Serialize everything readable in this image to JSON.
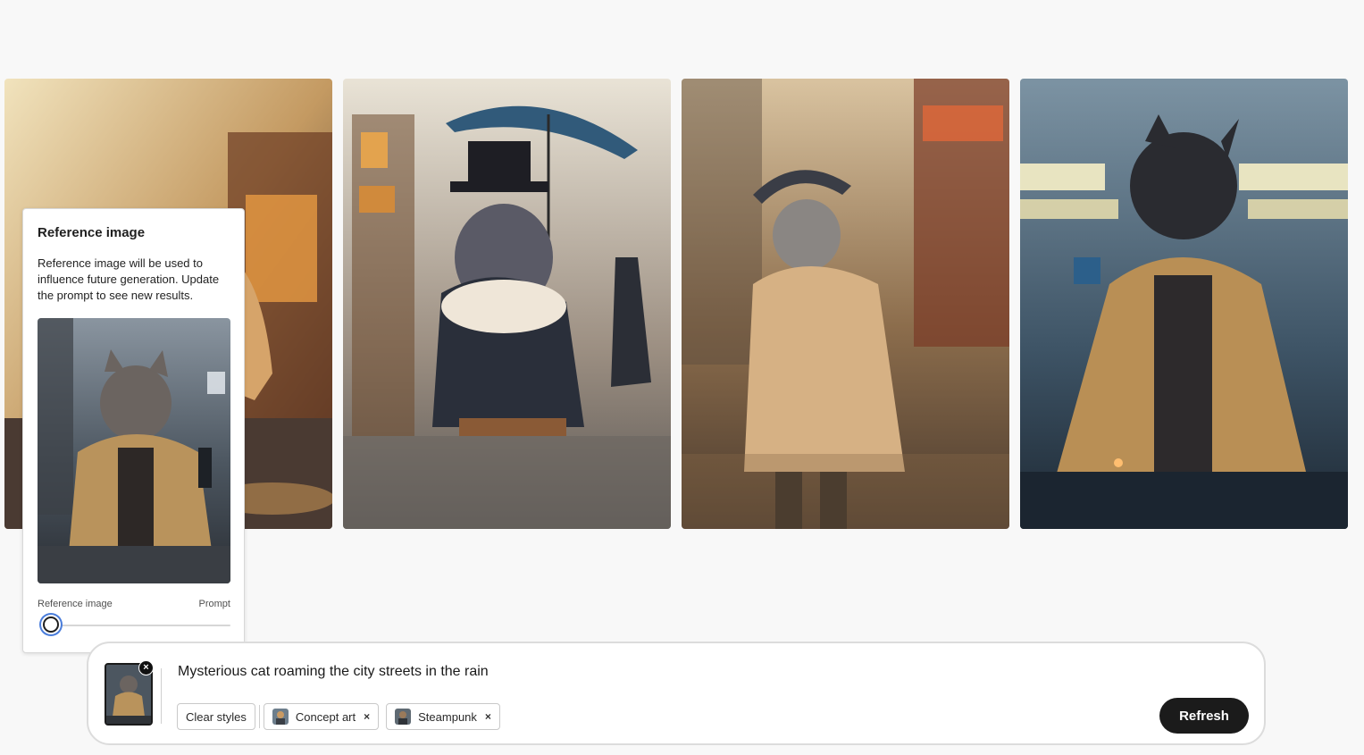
{
  "gallery": {
    "images": [
      {
        "alt": "cat-in-yellow-coat-neon-street"
      },
      {
        "alt": "cat-with-top-hat-and-umbrella"
      },
      {
        "alt": "cat-in-raincoat-walking"
      },
      {
        "alt": "black-cat-in-yellow-cloak"
      }
    ]
  },
  "reference_popover": {
    "title": "Reference image",
    "description": "Reference image will be used to influence future generation. Update the prompt to see new results.",
    "slider_left_label": "Reference image",
    "slider_right_label": "Prompt",
    "slider_value": 0.04
  },
  "prompt_bar": {
    "prompt_text": "Mysterious cat roaming the city streets in the rain",
    "clear_styles_label": "Clear styles",
    "style_chips": [
      {
        "label": "Concept art",
        "icon": "concept-art-thumbnail-icon"
      },
      {
        "label": "Steampunk",
        "icon": "steampunk-thumbnail-icon"
      }
    ],
    "remove_symbol": "×",
    "refresh_label": "Refresh"
  },
  "colors": {
    "background": "#f8f8f8",
    "button_dark": "#1b1b1b",
    "slider_focus": "#4a7ddb",
    "coat_yellow": "#c9a268"
  }
}
